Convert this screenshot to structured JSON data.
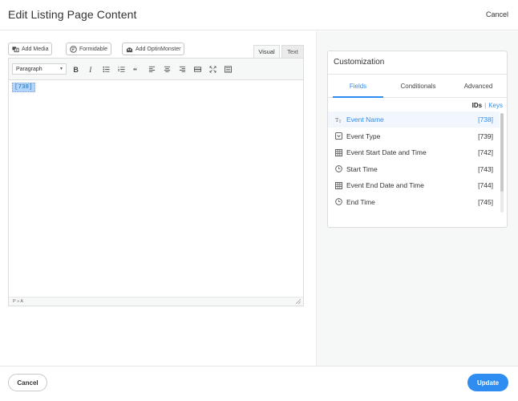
{
  "header": {
    "title": "Edit Listing Page Content",
    "cancel": "Cancel"
  },
  "media_buttons": [
    {
      "label": "Add Media",
      "icon": "add-media-icon"
    },
    {
      "label": "Formidable",
      "icon": "formidable-icon"
    },
    {
      "label": "Add OptinMonster",
      "icon": "optinmonster-icon"
    }
  ],
  "editor_tabs": {
    "visual": "Visual",
    "text": "Text"
  },
  "toolbar": {
    "format_select": "Paragraph",
    "buttons": [
      "bold-icon",
      "italic-icon",
      "bullet-list-icon",
      "numbered-list-icon",
      "blockquote-icon",
      "align-left-icon",
      "align-center-icon",
      "align-right-icon",
      "insert-link-icon",
      "fullscreen-icon",
      "toolbar-toggle-icon"
    ]
  },
  "editor": {
    "content": "[738]",
    "status_path": "P » A"
  },
  "customization": {
    "title": "Customization",
    "tabs": [
      {
        "label": "Fields",
        "active": true
      },
      {
        "label": "Conditionals",
        "active": false
      },
      {
        "label": "Advanced",
        "active": false
      }
    ],
    "toggle": {
      "ids": "IDs",
      "separator": "|",
      "keys": "Keys"
    },
    "fields": [
      {
        "name": "Event Name",
        "id": "[738]",
        "icon": "text-field-icon"
      },
      {
        "name": "Event Type",
        "id": "[739]",
        "icon": "dropdown-field-icon"
      },
      {
        "name": "Event Start Date and Time",
        "id": "[742]",
        "icon": "calendar-icon"
      },
      {
        "name": "Start Time",
        "id": "[743]",
        "icon": "clock-icon"
      },
      {
        "name": "Event End Date and Time",
        "id": "[744]",
        "icon": "calendar-icon"
      },
      {
        "name": "End Time",
        "id": "[745]",
        "icon": "clock-icon"
      }
    ]
  },
  "footer": {
    "cancel": "Cancel",
    "update": "Update"
  },
  "colors": {
    "accent": "#2f8cf0",
    "panel_bg": "#f6f7f7"
  }
}
